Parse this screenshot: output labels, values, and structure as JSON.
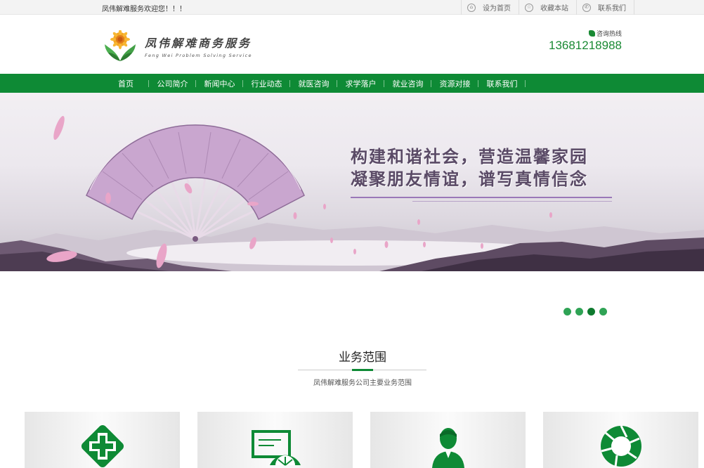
{
  "topbar": {
    "welcome": "凤伟解难服务欢迎您！！！",
    "links": [
      {
        "label": "设为首页",
        "icon": "home-icon"
      },
      {
        "label": "收藏本站",
        "icon": "star-icon"
      },
      {
        "label": "联系我们",
        "icon": "phone-icon"
      }
    ]
  },
  "header": {
    "logo_cn": "凤伟解难商务服务",
    "logo_en": "Feng Wei Problem Solving Service",
    "hotline_label": "咨询热线",
    "hotline_number": "13681218988"
  },
  "nav": {
    "items": [
      "首页",
      "公司简介",
      "新闻中心",
      "行业动态",
      "就医咨询",
      "求学落户",
      "就业咨询",
      "资源对接",
      "联系我们"
    ]
  },
  "banner": {
    "line1": "构建和谐社会，营造温馨家园",
    "line2": "凝聚朋友情谊，谱写真情信念",
    "slide_count": 4,
    "active_slide": 3
  },
  "section": {
    "title": "业务范围",
    "subtitle": "凤伟解难服务公司主要业务范围"
  },
  "cards": [
    {
      "icon": "medical-cross-icon"
    },
    {
      "icon": "education-fan-icon"
    },
    {
      "icon": "person-icon"
    },
    {
      "icon": "aperture-icon"
    }
  ],
  "colors": {
    "brand_green": "#0e8a35",
    "hotline_green": "#1a8a34",
    "slogan_purple": "#5a4a66"
  }
}
